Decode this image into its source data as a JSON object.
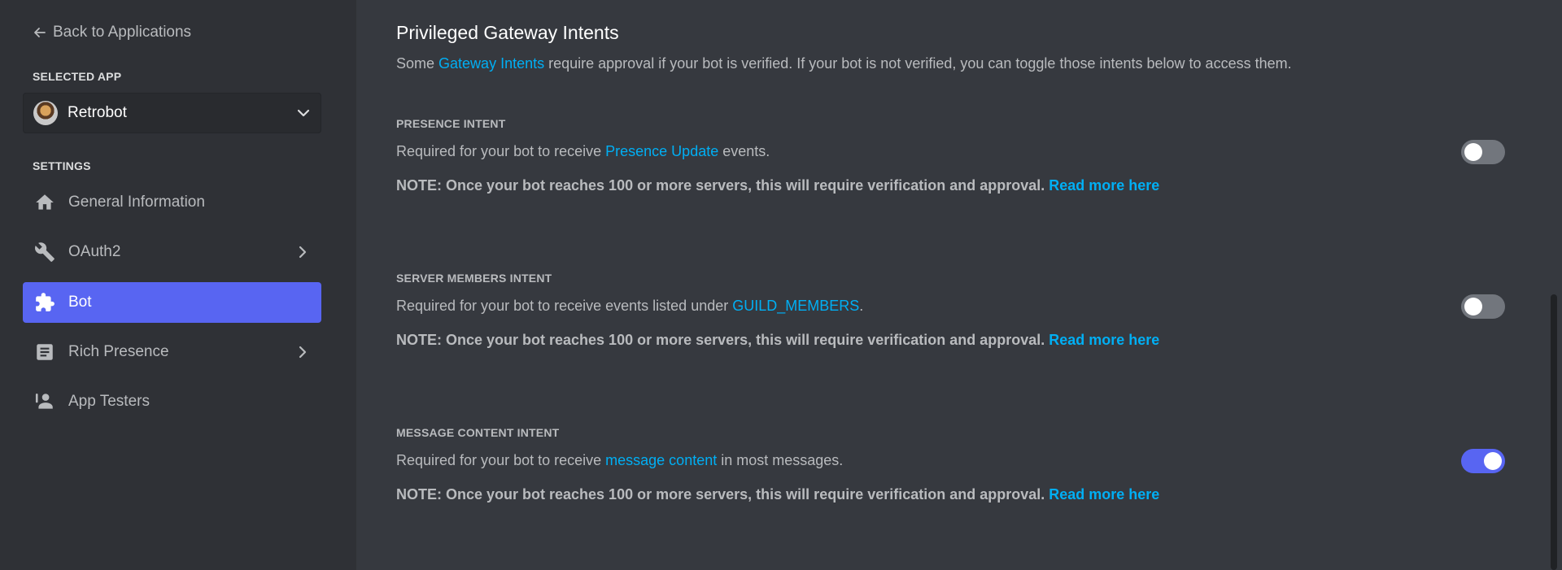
{
  "sidebar": {
    "back_label": "Back to Applications",
    "selected_app_label": "SELECTED APP",
    "app_name": "Retrobot",
    "settings_label": "SETTINGS",
    "items": [
      {
        "label": "General Information",
        "icon": "home-icon",
        "active": false,
        "chevron": false
      },
      {
        "label": "OAuth2",
        "icon": "wrench-icon",
        "active": false,
        "chevron": true
      },
      {
        "label": "Bot",
        "icon": "puzzle-icon",
        "active": true,
        "chevron": false
      },
      {
        "label": "Rich Presence",
        "icon": "document-icon",
        "active": false,
        "chevron": true
      },
      {
        "label": "App Testers",
        "icon": "person-icon",
        "active": false,
        "chevron": false
      }
    ]
  },
  "main": {
    "title": "Privileged Gateway Intents",
    "desc_pre": "Some ",
    "desc_link": "Gateway Intents",
    "desc_post": " require approval if your bot is verified. If your bot is not verified, you can toggle those intents below to access them.",
    "intents": [
      {
        "title": "PRESENCE INTENT",
        "desc_pre": "Required for your bot to receive ",
        "desc_link": "Presence Update",
        "desc_post": " events.",
        "note": "NOTE: Once your bot reaches 100 or more servers, this will require verification and approval. ",
        "read_more": "Read more here",
        "enabled": false
      },
      {
        "title": "SERVER MEMBERS INTENT",
        "desc_pre": "Required for your bot to receive events listed under ",
        "desc_link": "GUILD_MEMBERS",
        "desc_post": ".",
        "note": "NOTE: Once your bot reaches 100 or more servers, this will require verification and approval. ",
        "read_more": "Read more here",
        "enabled": false
      },
      {
        "title": "MESSAGE CONTENT INTENT",
        "desc_pre": "Required for your bot to receive ",
        "desc_link": "message content",
        "desc_post": " in most messages.",
        "note": "NOTE: Once your bot reaches 100 or more servers, this will require verification and approval. ",
        "read_more": "Read more here",
        "enabled": true
      }
    ]
  },
  "colors": {
    "accent": "#5865f2",
    "link": "#00aff4",
    "sidebar_bg": "#2f3136",
    "main_bg": "#36393f"
  }
}
